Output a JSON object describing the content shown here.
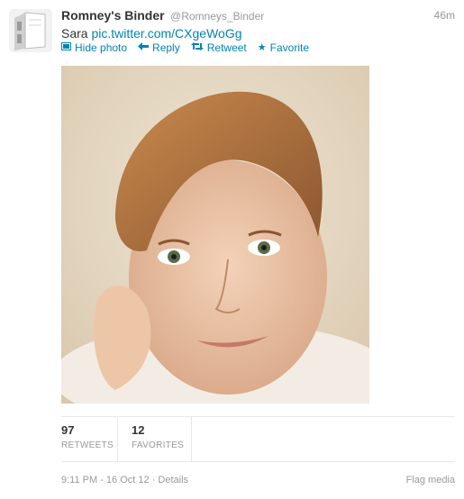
{
  "tweet": {
    "author_name": "Romney's Binder",
    "author_handle": "@Romneys_Binder",
    "time_ago": "46m",
    "text": "Sara",
    "link_text": "pic.twitter.com/CXgeWoGg",
    "avatar_icon": "binder-icon"
  },
  "actions": {
    "hide_photo": "Hide photo",
    "reply": "Reply",
    "retweet": "Retweet",
    "favorite": "Favorite"
  },
  "stats": {
    "retweets_count": "97",
    "retweets_label": "RETWEETS",
    "favorites_count": "12",
    "favorites_label": "FAVORITES"
  },
  "footer": {
    "timestamp": "9:11 PM - 16 Oct 12",
    "separator": "·",
    "details": "Details",
    "flag_media": "Flag media"
  },
  "colors": {
    "link": "#0084b4",
    "muted": "#999999",
    "text": "#333333"
  }
}
